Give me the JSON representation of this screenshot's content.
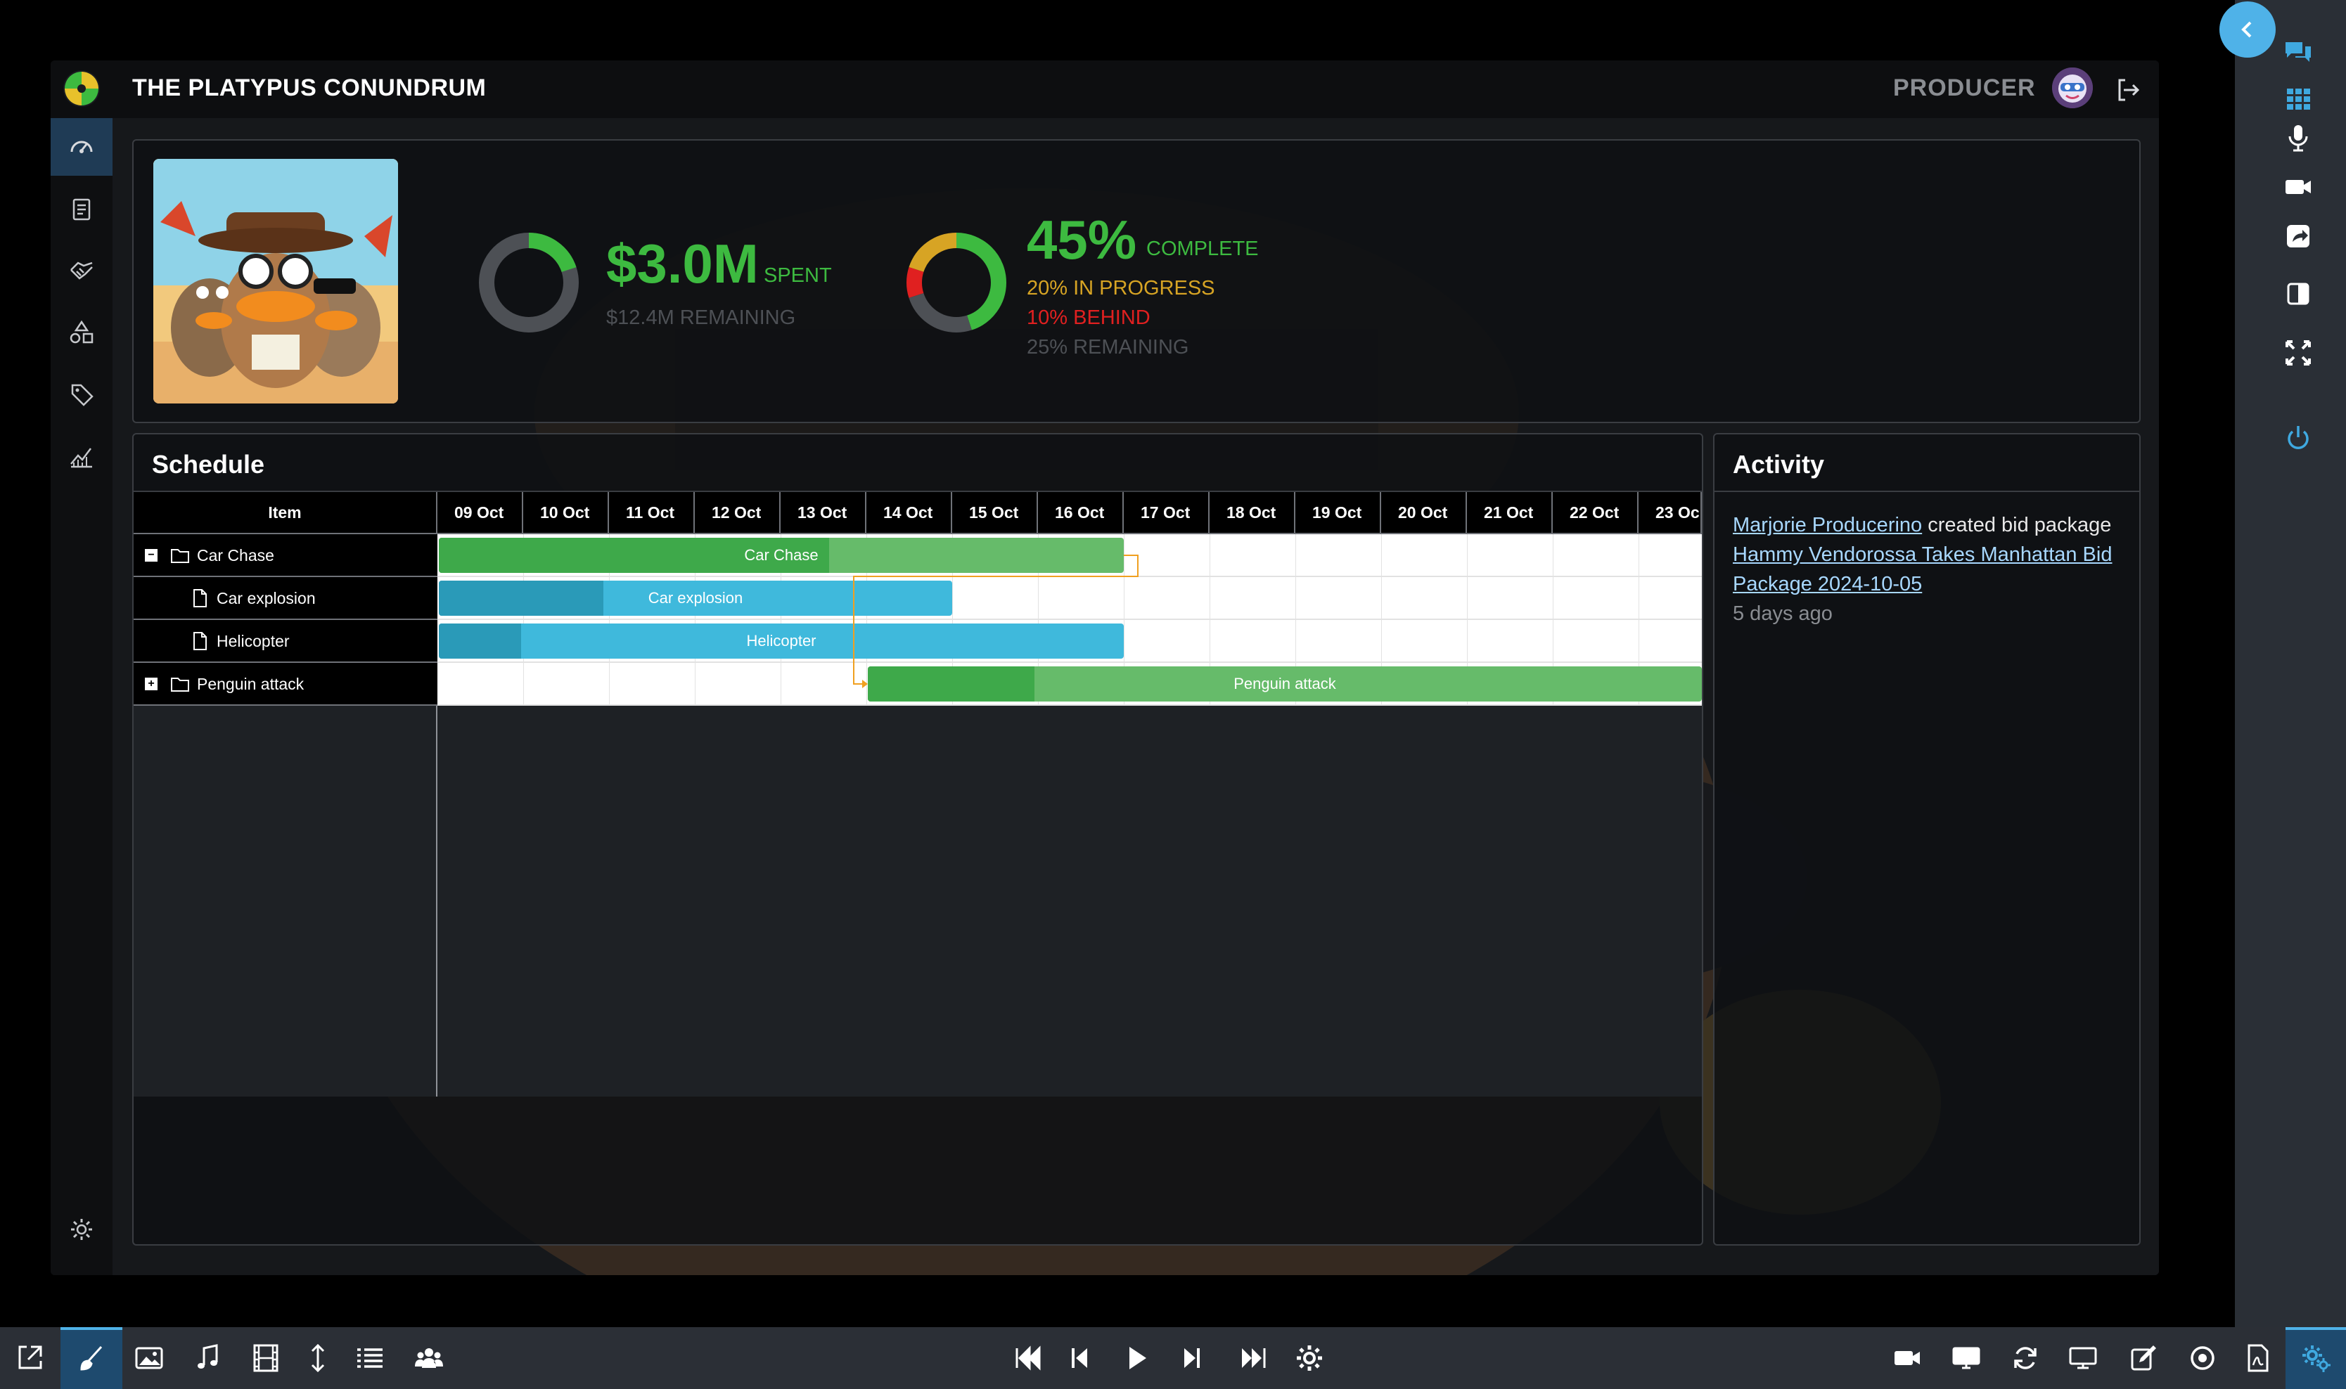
{
  "app": {
    "title": "THE PLATYPUS CONUNDRUM",
    "role": "PRODUCER",
    "logo_icon": "pinwheel-logo-icon",
    "logout_icon": "logout-icon"
  },
  "sidebar": {
    "items": [
      {
        "name": "dashboard",
        "icon": "speedometer-icon",
        "active": true
      },
      {
        "name": "tasks",
        "icon": "clipboard-icon"
      },
      {
        "name": "budget",
        "icon": "handshake-icon"
      },
      {
        "name": "assets",
        "icon": "shapes-icon"
      },
      {
        "name": "tags",
        "icon": "tag-icon"
      },
      {
        "name": "analytics",
        "icon": "chart-icon"
      }
    ],
    "settings_icon": "gear-icon"
  },
  "summary": {
    "spent_value": "$3.0M",
    "spent_label": "SPENT",
    "remaining_label": "$12.4M REMAINING",
    "spent_fraction": 0.2,
    "complete_value": "45%",
    "complete_label": "COMPLETE",
    "in_progress": "20% IN PROGRESS",
    "behind": "10% BEHIND",
    "remaining": "25% REMAINING",
    "progress_breakdown": {
      "complete": 45,
      "in_progress": 20,
      "behind": 10,
      "remaining": 25
    },
    "colors": {
      "green": "#3dba40",
      "amber": "#d7a424",
      "red": "#e02020",
      "grey": "#4d5055"
    }
  },
  "schedule": {
    "title": "Schedule",
    "item_header": "Item",
    "dates": [
      "09 Oct",
      "10 Oct",
      "11 Oct",
      "12 Oct",
      "13 Oct",
      "14 Oct",
      "15 Oct",
      "16 Oct",
      "17 Oct",
      "18 Oct",
      "19 Oct",
      "20 Oct",
      "21 Oct",
      "22 Oct",
      "23 Oc"
    ],
    "rows": [
      {
        "label": "Car Chase",
        "kind": "folder",
        "expanded": true,
        "start": 0,
        "duration": 8,
        "progress": 0.57,
        "color": "green"
      },
      {
        "label": "Car explosion",
        "kind": "file",
        "start": 0,
        "duration": 6,
        "progress": 0.32,
        "color": "blue"
      },
      {
        "label": "Helicopter",
        "kind": "file",
        "start": 0,
        "duration": 8,
        "progress": 0.12,
        "color": "blue"
      },
      {
        "label": "Penguin attack",
        "kind": "folder",
        "expanded": false,
        "start": 5,
        "duration": 10,
        "progress": 0.2,
        "color": "green"
      }
    ]
  },
  "activity": {
    "title": "Activity",
    "user": "Marjorie Producerino",
    "action": " created bid package ",
    "target": "Hammy Vendorossa Takes Manhattan Bid Package 2024-10-05",
    "time": "5 days ago"
  },
  "rail": {
    "icons": [
      "chat-icon",
      "grid-icon",
      "microphone-icon",
      "video-camera-icon",
      "share-screen-icon",
      "sidebar-toggle-icon",
      "fullscreen-icon",
      "power-icon"
    ]
  },
  "bottombar": {
    "left_icons": [
      "external-link-icon",
      "brush-icon",
      "image-icon",
      "music-icon",
      "film-icon",
      "vertical-resize-icon",
      "list-icon",
      "users-icon"
    ],
    "center_icons": [
      "skip-start-icon",
      "previous-icon",
      "play-icon",
      "next-icon",
      "skip-end-icon",
      "settings-icon"
    ],
    "right_icons": [
      "camera-icon",
      "display-icon",
      "refresh-icon",
      "monitor-icon",
      "edit-icon",
      "record-icon",
      "pdf-icon",
      "gears-icon"
    ]
  }
}
